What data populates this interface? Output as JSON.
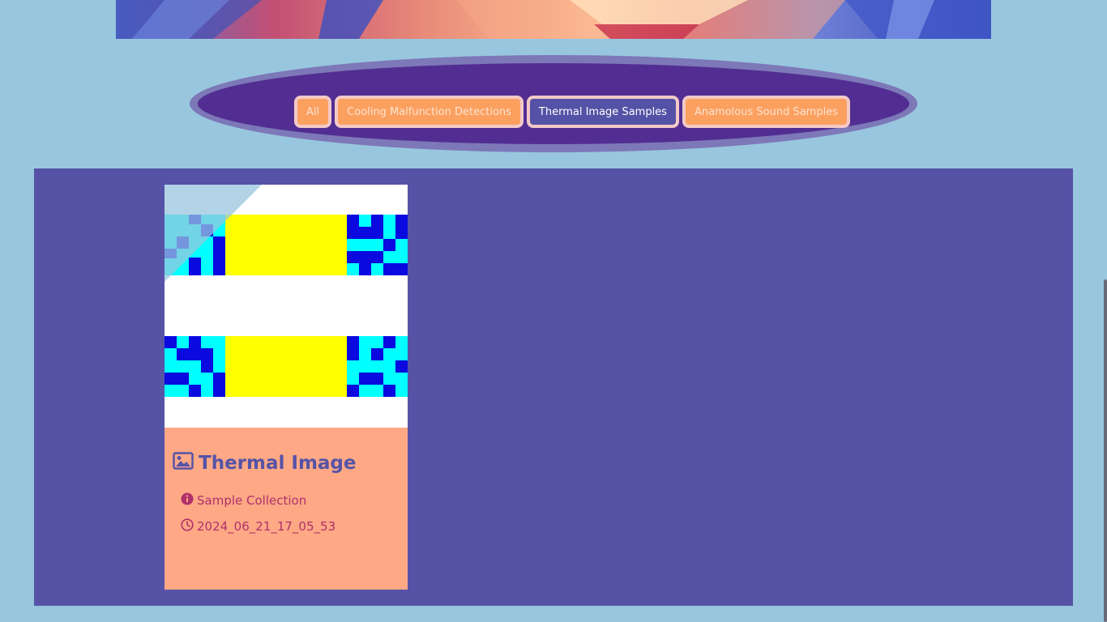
{
  "filters": [
    {
      "label": "All",
      "active": false
    },
    {
      "label": "Cooling Malfunction Detections",
      "active": false
    },
    {
      "label": "Thermal Image Samples",
      "active": true
    },
    {
      "label": "Anamolous Sound Samples",
      "active": false
    }
  ],
  "card": {
    "title": "Thermal Image",
    "title_icon": "image-icon",
    "collection": "Sample Collection",
    "collection_icon": "info-icon",
    "timestamp": "2024_06_21_17_05_53",
    "timestamp_icon": "clock-icon"
  },
  "colors": {
    "background": "#98c6de",
    "filter_bar": "#522e92",
    "main_panel": "#5653a7",
    "card": "#fea886",
    "button": "#fca060",
    "button_active": "#5452a6"
  }
}
